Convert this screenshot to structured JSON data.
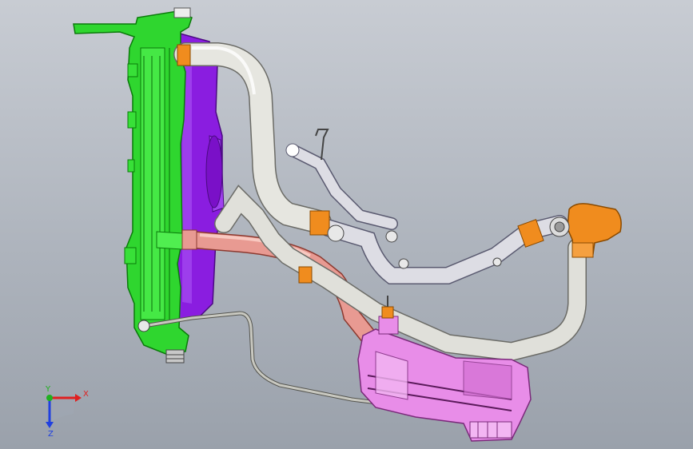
{
  "viewport": {
    "background_top": "#c8ccd3",
    "background_bottom": "#9aa1ab"
  },
  "parts": {
    "radiator": {
      "name": "radiator",
      "color": "#2fd62f",
      "edge": "#0a7a0a"
    },
    "fan_shroud": {
      "name": "fan-shroud",
      "color": "#8a1de0",
      "edge": "#4a0a80"
    },
    "upper_hose": {
      "name": "upper-radiator-hose",
      "color": "#e6e6e0",
      "edge": "#6b6b66"
    },
    "lower_hose": {
      "name": "lower-radiator-hose",
      "color": "#e89a92",
      "edge": "#8c3a30"
    },
    "bypass_pipe": {
      "name": "bypass-pipe",
      "color": "#dddde4",
      "edge": "#5a5a70"
    },
    "heater_hose": {
      "name": "heater-hose",
      "color": "#e0e0da",
      "edge": "#5a5a55"
    },
    "clamps": {
      "name": "hose-clamps",
      "color": "#f08c1e",
      "edge": "#8a4a00"
    },
    "thermostat_housing": {
      "name": "thermostat-housing",
      "color": "#f08c1e",
      "edge": "#8a4a00"
    },
    "expansion_tank": {
      "name": "expansion-tank",
      "color": "#e88de8",
      "edge": "#7a2a7a"
    },
    "overflow_line": {
      "name": "overflow-line",
      "color": "#c8c8c0",
      "edge": "#55554f"
    }
  },
  "triad": {
    "x_label": "X",
    "y_label": "Y",
    "z_label": "Z",
    "x_color": "#e02020",
    "y_color": "#20b020",
    "z_color": "#2040e0"
  }
}
